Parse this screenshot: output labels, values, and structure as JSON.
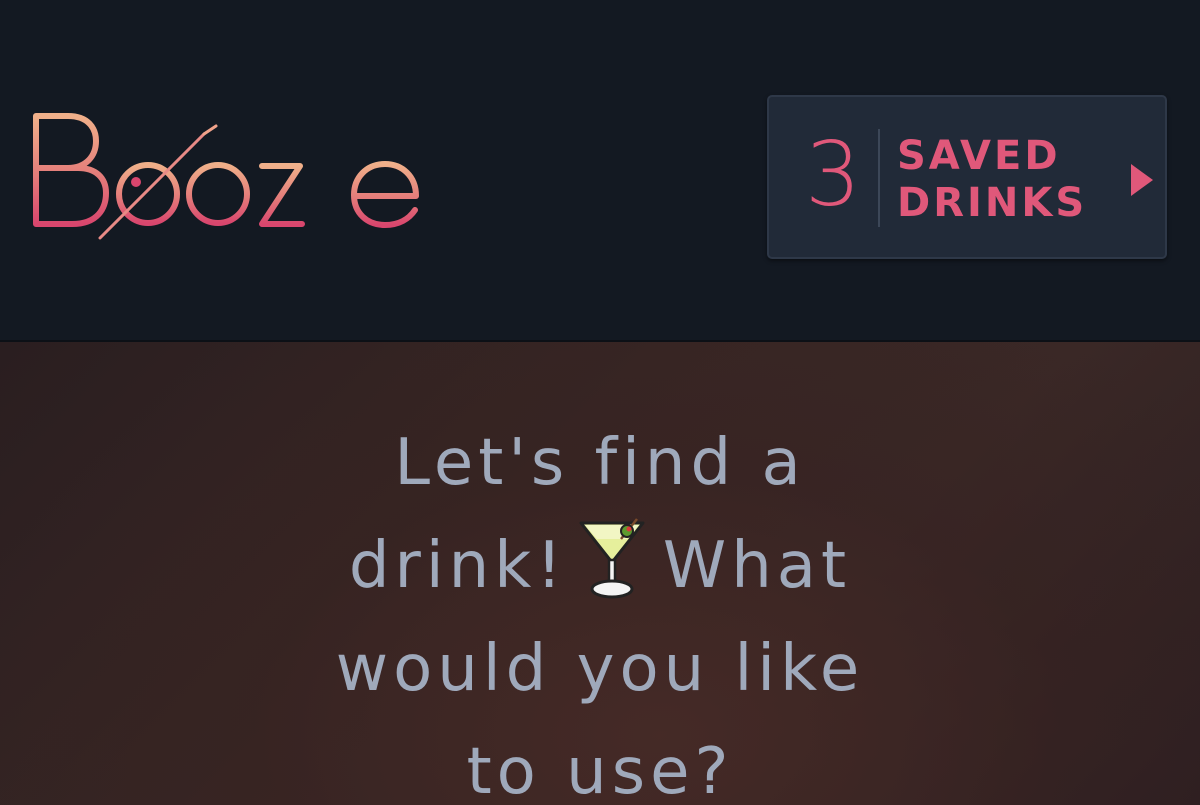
{
  "header": {
    "logo": {
      "text": "Boozle",
      "icon": "olive-pick-logo"
    },
    "saved_button": {
      "count": "3",
      "line1": "SAVED",
      "line2": "DRINKS",
      "arrow_icon": "triangle-right-icon"
    }
  },
  "main": {
    "prompt": {
      "line1": "Let's find a",
      "line2_before": "drink!",
      "line2_after": "What",
      "line3": "would you like",
      "line4": "to use?",
      "emoji_icon": "martini-icon"
    }
  },
  "colors": {
    "header_bg": "#131922",
    "accent": "#e0587a",
    "prompt_text": "#9fa9bb",
    "button_bg": "#212a38"
  }
}
